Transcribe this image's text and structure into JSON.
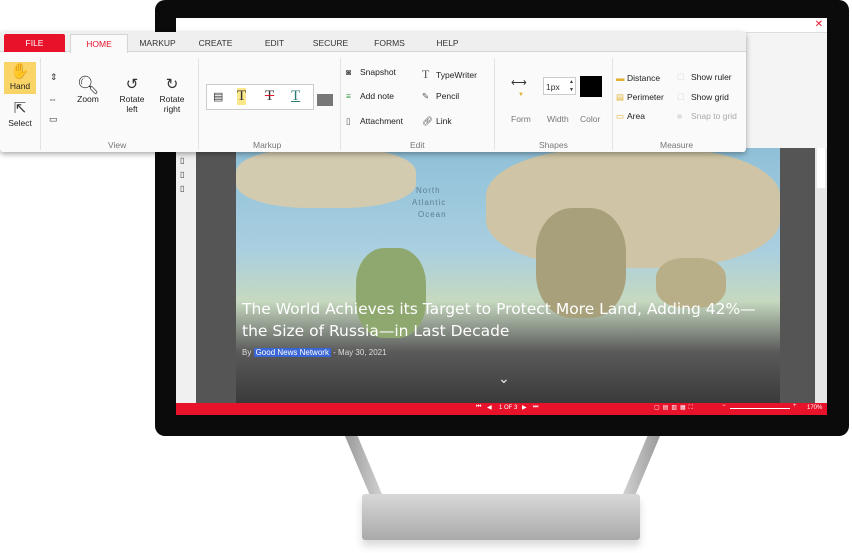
{
  "ribbon": {
    "tabs": [
      "FILE",
      "HOME",
      "MARKUP",
      "CREATE",
      "EDIT",
      "SECURE",
      "FORMS",
      "HELP"
    ],
    "view": {
      "hand": "Hand",
      "select": "Select",
      "zoom": "Zoom",
      "rotate_left": "Rotate left",
      "rotate_right": "Rotate right",
      "label": "View"
    },
    "markup": {
      "label": "Markup"
    },
    "edit": {
      "snapshot": "Snapshot",
      "add_note": "Add note",
      "attachment": "Attachment",
      "typewriter": "TypeWriter",
      "pencil": "Pencil",
      "link": "Link",
      "label": "Edit"
    },
    "shapes": {
      "form": "Form",
      "width_value": "1px",
      "width": "Width",
      "color": "Color",
      "color_value": "#000000",
      "label": "Shapes"
    },
    "measure": {
      "distance": "Distance",
      "perimeter": "Perimeter",
      "area": "Area",
      "show_ruler": "Show ruler",
      "show_grid": "Show grid",
      "snap_to_grid": "Snap to grid",
      "label": "Measure"
    }
  },
  "document": {
    "map_labels": [
      "North",
      "Atlantic",
      "Ocean"
    ],
    "title": "The World Achieves its Target to Protect More Land, Adding 42%—the Size of Russia—in Last Decade",
    "by": "By",
    "source": "Good News Network",
    "date": "- May 30, 2021"
  },
  "status": {
    "page": "1 OF 3",
    "zoom": "170%"
  },
  "colors": {
    "accent": "#e8132b",
    "highlight": "#fbd467"
  }
}
